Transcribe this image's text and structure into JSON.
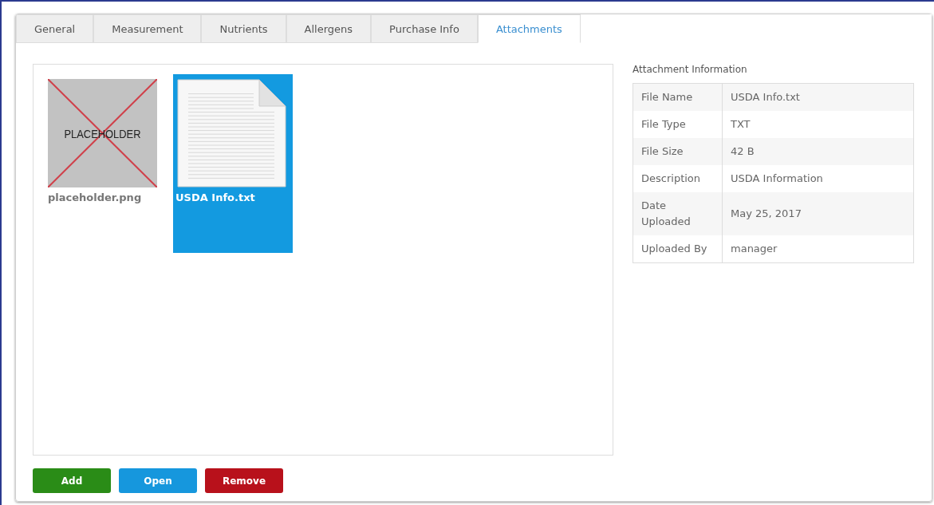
{
  "tabs": [
    {
      "label": "General",
      "selected": false
    },
    {
      "label": "Measurement",
      "selected": false
    },
    {
      "label": "Nutrients",
      "selected": false
    },
    {
      "label": "Allergens",
      "selected": false
    },
    {
      "label": "Purchase Info",
      "selected": false
    },
    {
      "label": "Attachments",
      "selected": true
    }
  ],
  "attachments": [
    {
      "name": "placeholder.png",
      "kind": "image",
      "thumbnail_text": "PLACEHOLDER",
      "selected": false
    },
    {
      "name": "USDA Info.txt",
      "kind": "text",
      "selected": true
    }
  ],
  "info": {
    "title": "Attachment Information",
    "rows": [
      {
        "label": "File Name",
        "value": "USDA Info.txt"
      },
      {
        "label": "File Type",
        "value": "TXT"
      },
      {
        "label": "File Size",
        "value": "42 B"
      },
      {
        "label": "Description",
        "value": "USDA Information"
      },
      {
        "label": "Date Uploaded",
        "value": "May 25, 2017"
      },
      {
        "label": "Uploaded By",
        "value": "manager"
      }
    ]
  },
  "buttons": [
    {
      "label": "Add",
      "kind": "add"
    },
    {
      "label": "Open",
      "kind": "open"
    },
    {
      "label": "Remove",
      "kind": "remove"
    }
  ]
}
